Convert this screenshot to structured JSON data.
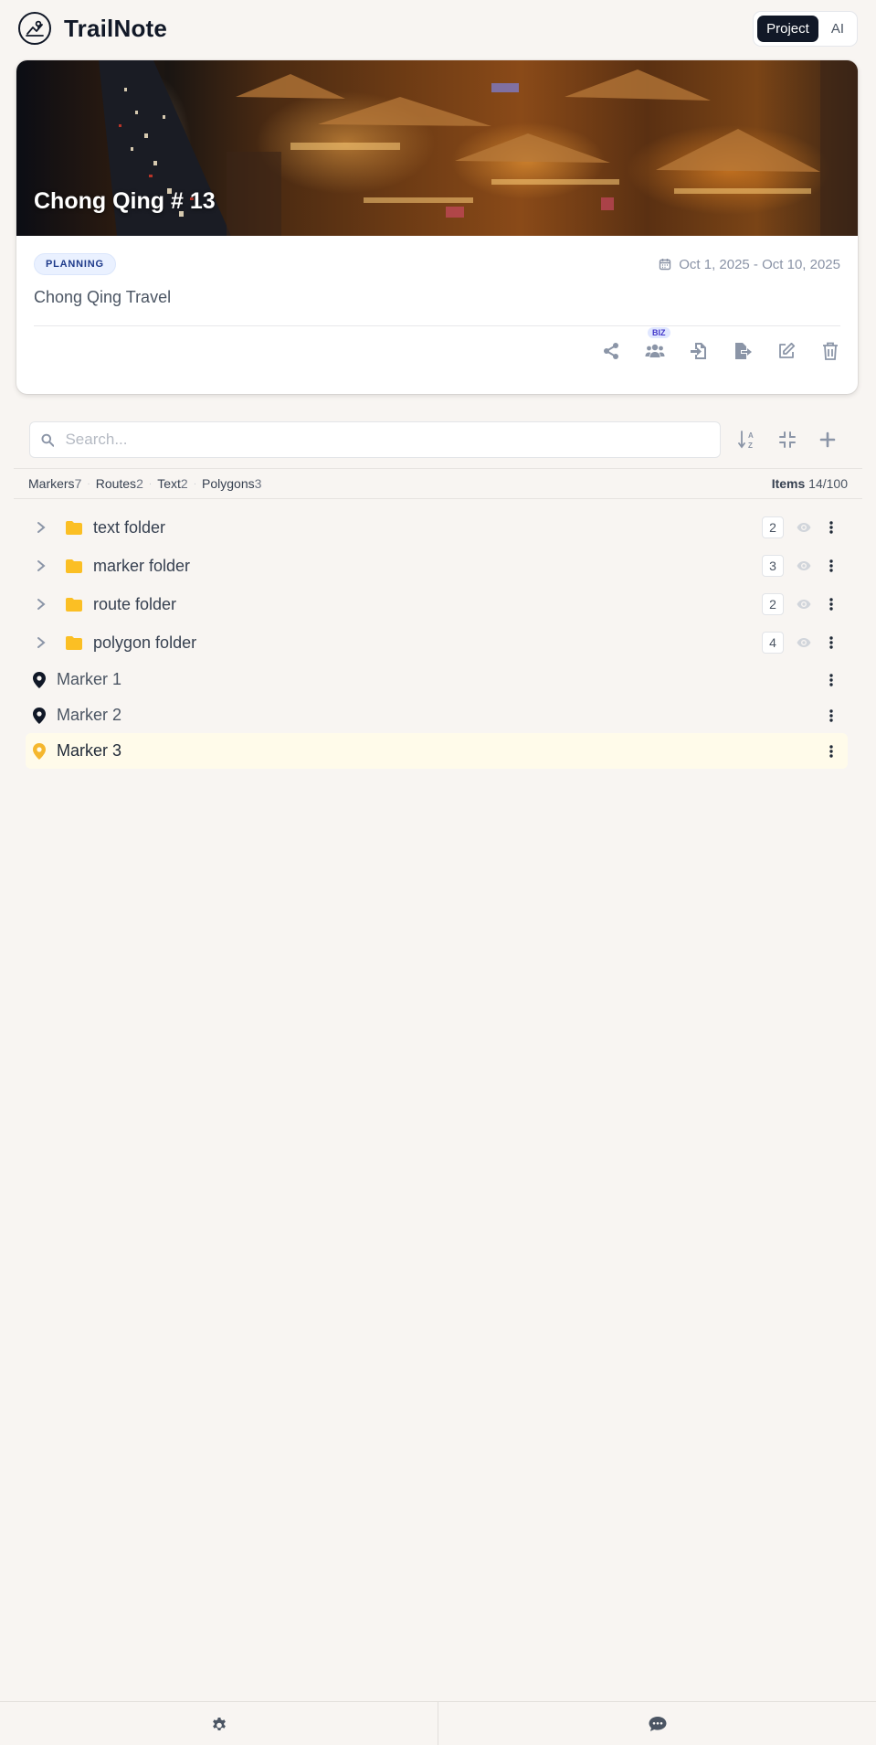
{
  "app": {
    "name": "TrailNote",
    "mode_tabs": [
      {
        "label": "Project",
        "active": true
      },
      {
        "label": "AI",
        "active": false
      }
    ]
  },
  "project": {
    "title": "Chong Qing # 13",
    "status": "PLANNING",
    "date_range": "Oct 1, 2025 - Oct 10, 2025",
    "description": "Chong Qing Travel",
    "biz_tag": "BIZ",
    "actions": [
      "share-icon",
      "users-icon",
      "import-icon",
      "export-icon",
      "edit-icon",
      "trash-icon"
    ]
  },
  "search": {
    "placeholder": "Search..."
  },
  "stats": {
    "markers_label": "Markers",
    "markers_count": "7",
    "routes_label": "Routes",
    "routes_count": "2",
    "text_label": "Text",
    "text_count": "2",
    "polygons_label": "Polygons",
    "polygons_count": "3",
    "items_label": "Items",
    "items_value": "14/100"
  },
  "tree": {
    "folders": [
      {
        "label": "text folder",
        "count": "2"
      },
      {
        "label": "marker folder",
        "count": "3"
      },
      {
        "label": "route folder",
        "count": "2"
      },
      {
        "label": "polygon folder",
        "count": "4"
      }
    ],
    "markers": [
      {
        "label": "Marker 1",
        "selected": false
      },
      {
        "label": "Marker 2",
        "selected": false
      },
      {
        "label": "Marker 3",
        "selected": true
      }
    ]
  },
  "colors": {
    "accent_dark": "#111827",
    "folder": "#fbbf24",
    "marker_default": "#111827",
    "marker_selected": "#f5b72e",
    "icon_gray": "#8b95a7"
  }
}
